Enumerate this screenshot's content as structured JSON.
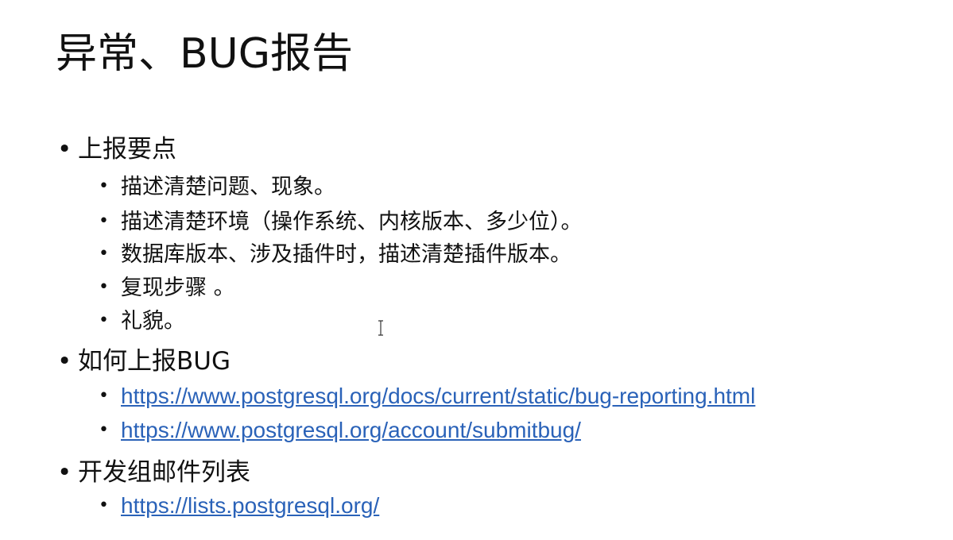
{
  "slide": {
    "title": "异常、BUG报告",
    "sections": [
      {
        "heading": "上报要点",
        "items": [
          "描述清楚问题、现象。",
          "描述清楚环境（操作系统、内核版本、多少位）。",
          "数据库版本、涉及插件时，描述清楚插件版本。",
          "复现步骤 。",
          "礼貌。"
        ]
      },
      {
        "heading": "如何上报BUG",
        "links": [
          "https://www.postgresql.org/docs/current/static/bug-reporting.html",
          "https://www.postgresql.org/account/submitbug/"
        ]
      },
      {
        "heading": "开发组邮件列表",
        "links": [
          "https://lists.postgresql.org/"
        ]
      }
    ],
    "link_color": "#2a62b8",
    "bullet_glyph": "•"
  }
}
